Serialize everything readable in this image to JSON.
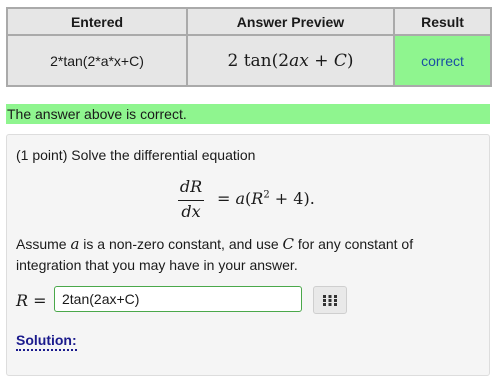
{
  "results": {
    "headers": [
      "Entered",
      "Answer Preview",
      "Result"
    ],
    "entered": "2*tan(2*a*x+C)",
    "preview_prefix": "2 tan(2",
    "preview_var1": "ax",
    "preview_plus": " + ",
    "preview_var2": "C",
    "preview_suffix": ")",
    "result": "correct"
  },
  "status_message": "The answer above is correct.",
  "problem": {
    "prompt": "(1 point) Solve the differential equation",
    "equation": {
      "numerator": "dR",
      "denominator": "dx",
      "rhs_start": "= ",
      "rhs_a": "a",
      "rhs_paren": "(",
      "rhs_R": "R",
      "rhs_exp": "2",
      "rhs_end": " + 4)."
    },
    "assume_1": "Assume ",
    "assume_a": "a",
    "assume_2": " is a non-zero constant, and use ",
    "assume_C": "C",
    "assume_3": " for any constant of integration that you may have in your answer.",
    "answer_label_var": "R",
    "answer_label_eq": " =",
    "answer_value": "2tan(2ax+C)",
    "solution_label": "Solution:"
  },
  "icons": {
    "keypad": "keypad-icon"
  },
  "colors": {
    "correct_bg": "#8ff58f",
    "link": "#1a1a8c",
    "input_border": "#4aa84a"
  }
}
